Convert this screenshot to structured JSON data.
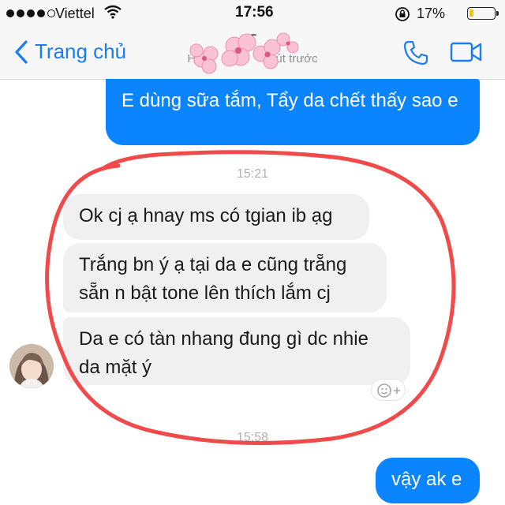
{
  "status_bar": {
    "carrier": "Viettel",
    "time": "17:56",
    "battery_percent": "17%",
    "battery_level": 0.17,
    "signal_bars_filled": 4,
    "signal_bars_total": 5
  },
  "nav": {
    "back_label": "Trang chủ",
    "contact_name": "T",
    "contact_status": "Hoạt",
    "contact_status_tail": "út trước",
    "call_icon": "phone-icon",
    "video_icon": "video-camera-icon"
  },
  "colors": {
    "accent": "#1d7cf2",
    "outgoing_bubble": "#0a84ff",
    "incoming_bubble": "#f1f0f0",
    "annotation_ring": "#f04a4a"
  },
  "messages": {
    "m1": "E dùng sữa tắm, Tẩy da chết thấy sao e",
    "ts1": "15:21",
    "m2": "Ok cj ạ hnay ms có tgian ib ạg",
    "m3": "Trắng bn ý ạ tại da e cũng trẵng sẵn n bật tone lên thích lắm cj",
    "m4": "Da e có tàn nhang đung gì dc nhie da mặt ý",
    "ts2": "15:58",
    "m5": "vậy ak e"
  }
}
